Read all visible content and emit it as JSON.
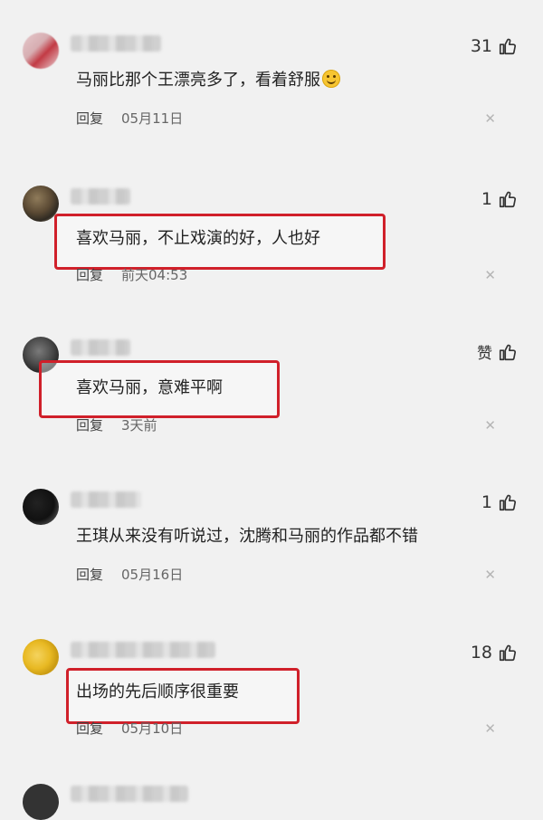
{
  "comments": [
    {
      "likes": "31",
      "text": "马丽比那个王漂亮多了，看着舒服",
      "emoji": "smile-face",
      "reply": "回复",
      "date": "05月11日"
    },
    {
      "likes": "1",
      "text": "喜欢马丽，不止戏演的好，人也好",
      "reply": "回复",
      "date": "前天04:53"
    },
    {
      "likes": "赞",
      "text": "喜欢马丽，意难平啊",
      "reply": "回复",
      "date": "3天前"
    },
    {
      "likes": "1",
      "text": "王琪从来没有听说过，沈腾和马丽的作品都不错",
      "reply": "回复",
      "date": "05月16日"
    },
    {
      "likes": "18",
      "text": "出场的先后顺序很重要",
      "reply": "回复",
      "date": "05月10日"
    }
  ],
  "colors": {
    "highlight": "#d0202a",
    "background": "#f1f1f1"
  }
}
